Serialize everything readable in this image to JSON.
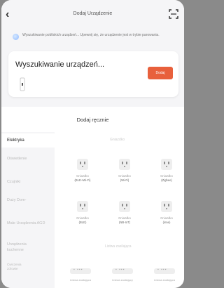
{
  "header": {
    "title": "Dodaj Urządzenie"
  },
  "hint": {
    "text": "Wyszukiwanie pobliskich urządzeń... Upewnij się, że urządzenie jest w trybie parowania."
  },
  "search": {
    "title": "Wyszukiwanie urządzeń...",
    "add_label": "Dodaj"
  },
  "manual": {
    "label": "Dodaj ręcznie"
  },
  "sidebar": {
    "items": [
      {
        "label": "Elektryka"
      },
      {
        "label": "Oświetlenie"
      },
      {
        "label": "Czujniki"
      },
      {
        "label": "Duży Dom-"
      },
      {
        "label": "Małe Urządzenia AGD"
      },
      {
        "label": "Urządzenia kuchenne"
      },
      {
        "label": "Ćwiczenia zdrowie"
      }
    ]
  },
  "sections": {
    "sockets_title": "Gniazdko",
    "strips_title": "Listwa zasilająca"
  },
  "devices": [
    {
      "name": "Gniazdko",
      "proto": "(BLE+Wi-Fi)"
    },
    {
      "name": "Gniazdko",
      "proto": "(Wi-Fi)"
    },
    {
      "name": "Gniazdko",
      "proto": "(Zigbee)"
    },
    {
      "name": "Gniazdko",
      "proto": "(BLE)"
    },
    {
      "name": "Gniazdko",
      "proto": "(NB-IoT)"
    },
    {
      "name": "Gniazdko",
      "proto": "(inne)"
    }
  ],
  "strips": [
    {
      "name": "Listwa zasilająca"
    },
    {
      "name": "Listwa zasilający"
    },
    {
      "name": "Listwa zasilająca"
    }
  ]
}
